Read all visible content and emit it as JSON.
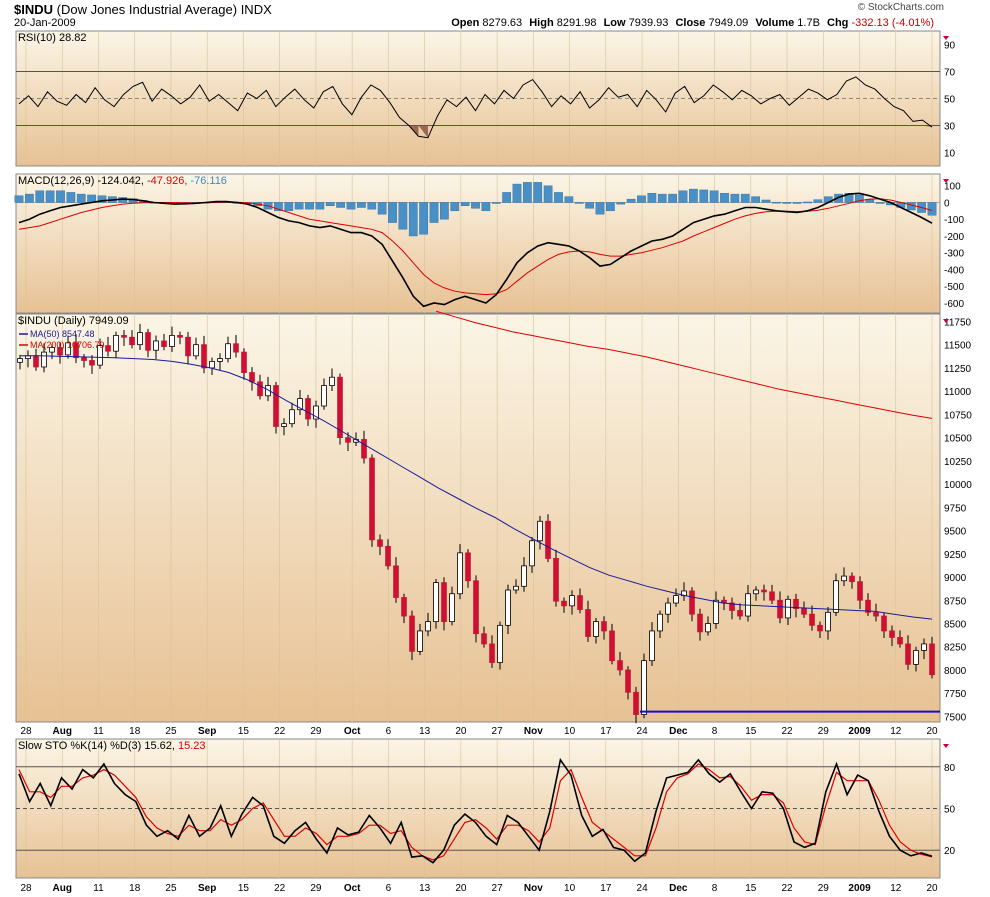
{
  "header": {
    "symbol": "$INDU",
    "name": "(Dow Jones Industrial Average)",
    "exchange": "INDX",
    "date": "20-Jan-2009",
    "brand": "© StockCharts.com",
    "open_label": "Open",
    "open": "8279.63",
    "high_label": "High",
    "high": "8291.98",
    "low_label": "Low",
    "low": "7939.93",
    "close_label": "Close",
    "close": "7949.09",
    "volume_label": "Volume",
    "volume": "1.7B",
    "chg_label": "Chg",
    "chg": "-332.13 (-4.01%)"
  },
  "colors": {
    "panel_bg_top": "#fbf5e6",
    "panel_bg_bottom": "#e7c193",
    "up": "#ffffff",
    "down": "#cc1133",
    "ma50": "#1a1a99",
    "ma200": "#dd0000",
    "macd_hist": "#4a90c8",
    "support": "#1010d0"
  },
  "chart_data": [
    {
      "type": "line",
      "panel": "rsi",
      "title": "RSI(10) 28.82",
      "y_ticks": [
        10,
        30,
        50,
        70,
        90
      ],
      "ylim": [
        0,
        100
      ],
      "reference_lines": [
        30,
        50,
        70
      ],
      "series": [
        {
          "name": "RSI(10)",
          "values": [
            46,
            52,
            44,
            55,
            48,
            45,
            53,
            47,
            58,
            49,
            44,
            53,
            59,
            62,
            48,
            57,
            52,
            46,
            51,
            60,
            48,
            53,
            47,
            41,
            54,
            50,
            56,
            44,
            51,
            57,
            49,
            43,
            55,
            59,
            46,
            38,
            51,
            60,
            56,
            47,
            36,
            30,
            22,
            21,
            37,
            49,
            44,
            51,
            41,
            53,
            46,
            56,
            50,
            60,
            64,
            55,
            44,
            52,
            46,
            55,
            43,
            49,
            58,
            51,
            53,
            44,
            56,
            49,
            40,
            54,
            59,
            47,
            52,
            60,
            55,
            49,
            56,
            52,
            46,
            50,
            53,
            45,
            51,
            57,
            54,
            49,
            53,
            63,
            66,
            60,
            57,
            50,
            44,
            41,
            33,
            34,
            28.82
          ]
        }
      ]
    },
    {
      "type": "line",
      "panel": "macd",
      "title": "MACD(12,26,9)",
      "values_text": {
        "macd": "-124.042",
        "signal": "-47.926",
        "hist": "-76.116"
      },
      "y_ticks": [
        100,
        0,
        -100,
        -200,
        -300,
        -400,
        -500,
        -600
      ],
      "ylim": [
        -660,
        170
      ],
      "series": [
        {
          "name": "MACD",
          "values": [
            -120,
            -100,
            -70,
            -50,
            -30,
            -20,
            -10,
            0,
            10,
            15,
            20,
            18,
            10,
            0,
            -5,
            -10,
            -8,
            -5,
            0,
            5,
            5,
            0,
            -10,
            -30,
            -60,
            -90,
            -110,
            -120,
            -140,
            -150,
            -140,
            -160,
            -180,
            -180,
            -200,
            -250,
            -350,
            -450,
            -560,
            -620,
            -600,
            -610,
            -580,
            -560,
            -580,
            -600,
            -550,
            -460,
            -360,
            -300,
            -260,
            -240,
            -250,
            -260,
            -290,
            -330,
            -380,
            -370,
            -330,
            -290,
            -260,
            -230,
            -220,
            -200,
            -160,
            -120,
            -100,
            -80,
            -70,
            -50,
            -30,
            -30,
            -40,
            -50,
            -55,
            -60,
            -50,
            -30,
            0,
            30,
            50,
            55,
            40,
            20,
            0,
            -30,
            -60,
            -90,
            -124.042
          ]
        },
        {
          "name": "Signal",
          "values": [
            -160,
            -150,
            -140,
            -120,
            -100,
            -80,
            -60,
            -45,
            -30,
            -20,
            -10,
            -5,
            -2,
            -1,
            0,
            -1,
            -2,
            -3,
            -1,
            0,
            1,
            1,
            -2,
            -10,
            -20,
            -40,
            -60,
            -80,
            -100,
            -110,
            -120,
            -130,
            -140,
            -150,
            -160,
            -180,
            -230,
            -290,
            -360,
            -430,
            -480,
            -510,
            -530,
            -540,
            -545,
            -550,
            -545,
            -520,
            -470,
            -420,
            -380,
            -340,
            -310,
            -295,
            -290,
            -295,
            -310,
            -320,
            -320,
            -310,
            -300,
            -285,
            -270,
            -250,
            -230,
            -200,
            -175,
            -150,
            -125,
            -100,
            -80,
            -65,
            -55,
            -52,
            -52,
            -54,
            -53,
            -47,
            -35,
            -20,
            -5,
            10,
            20,
            22,
            15,
            0,
            -15,
            -30,
            -47.926
          ]
        }
      ],
      "histogram": [
        40,
        50,
        70,
        70,
        70,
        60,
        50,
        45,
        40,
        35,
        30,
        23,
        12,
        1,
        -5,
        -9,
        -6,
        -2,
        1,
        5,
        4,
        -1,
        -8,
        -20,
        -40,
        -50,
        -50,
        -40,
        -40,
        -40,
        -20,
        -30,
        -40,
        -30,
        -40,
        -70,
        -120,
        -160,
        -200,
        -190,
        -120,
        -100,
        -50,
        -20,
        -35,
        -50,
        -5,
        60,
        110,
        120,
        120,
        100,
        60,
        35,
        0,
        -35,
        -70,
        -50,
        -10,
        20,
        40,
        55,
        50,
        50,
        70,
        80,
        75,
        70,
        55,
        50,
        50,
        35,
        15,
        2,
        -3,
        -6,
        3,
        17,
        35,
        50,
        55,
        45,
        20,
        -2,
        -15,
        -30,
        -45,
        -60,
        -76.116
      ]
    },
    {
      "type": "bar",
      "panel": "price",
      "title": "$INDU (Daily) 7949.09",
      "legend": [
        {
          "name": "MA(50) 8547.48",
          "color": "#1a1a99"
        },
        {
          "name": "MA(200) 10706.79",
          "color": "#dd0000"
        }
      ],
      "y_ticks": [
        7500,
        7750,
        8000,
        8250,
        8500,
        8750,
        9000,
        9250,
        9500,
        9750,
        10000,
        10250,
        10500,
        10750,
        11000,
        11250,
        11500,
        11750
      ],
      "ylim": [
        7440,
        11830
      ],
      "x_ticks": [
        "28",
        "Aug",
        "11",
        "18",
        "25",
        "Sep",
        "15",
        "22",
        "29",
        "Oct",
        "6",
        "13",
        "20",
        "27",
        "Nov",
        "10",
        "17",
        "24",
        "Dec",
        "8",
        "15",
        "22",
        "29",
        "2009",
        "12",
        "20"
      ],
      "closes": [
        11350,
        11380,
        11260,
        11420,
        11470,
        11390,
        11520,
        11360,
        11330,
        11280,
        11490,
        11430,
        11600,
        11580,
        11500,
        11630,
        11440,
        11540,
        11480,
        11600,
        11580,
        11380,
        11500,
        11250,
        11320,
        11350,
        11510,
        11420,
        11200,
        11100,
        10950,
        11060,
        10620,
        10650,
        10800,
        10920,
        10700,
        10840,
        11060,
        11150,
        10500,
        10450,
        10480,
        10280,
        9400,
        9330,
        9120,
        8780,
        8580,
        8200,
        8420,
        8520,
        8940,
        8520,
        8820,
        9260,
        8960,
        8390,
        8280,
        8080,
        8480,
        8860,
        8900,
        9120,
        9390,
        9600,
        9200,
        8740,
        8690,
        8800,
        8650,
        8360,
        8520,
        8420,
        8100,
        8000,
        7760,
        7520,
        8100,
        8420,
        8600,
        8720,
        8800,
        8850,
        8600,
        8410,
        8500,
        8750,
        8720,
        8640,
        8580,
        8820,
        8860,
        8840,
        8750,
        8560,
        8760,
        8660,
        8600,
        8480,
        8420,
        8620,
        8960,
        9010,
        8950,
        8750,
        8620,
        8580,
        8420,
        8350,
        8280,
        8060,
        8210,
        8280,
        7949.09
      ],
      "ma50": [
        11380,
        11380,
        11375,
        11370,
        11365,
        11360,
        11350,
        11340,
        11320,
        11290,
        11250,
        11200,
        11120,
        11020,
        10900,
        10790,
        10680,
        10560,
        10440,
        10320,
        10200,
        10080,
        9960,
        9850,
        9740,
        9640,
        9520,
        9410,
        9300,
        9200,
        9100,
        9020,
        8960,
        8900,
        8850,
        8800,
        8760,
        8720,
        8700,
        8690,
        8680,
        8670,
        8660,
        8650,
        8640,
        8630,
        8600,
        8570,
        8547.48
      ],
      "ma200": [
        11860,
        11800,
        11740,
        11690,
        11640,
        11600,
        11560,
        11520,
        11480,
        11450,
        11410,
        11370,
        11320,
        11270,
        11220,
        11170,
        11120,
        11070,
        11020,
        10980,
        10940,
        10900,
        10860,
        10820,
        10780,
        10740,
        10706.79
      ],
      "support_line": 7552
    },
    {
      "type": "line",
      "panel": "stochastic",
      "title": "Slow STO %K(14) %D(3)",
      "values_text": {
        "k": "15.62",
        "d": "15.23"
      },
      "y_ticks": [
        20,
        50,
        80
      ],
      "ylim": [
        0,
        100
      ],
      "reference_lines": [
        20,
        50,
        80
      ],
      "series": [
        {
          "name": "%K(14)",
          "values": [
            75,
            55,
            68,
            52,
            72,
            64,
            78,
            72,
            82,
            68,
            60,
            55,
            38,
            30,
            34,
            28,
            45,
            30,
            36,
            52,
            30,
            46,
            58,
            52,
            30,
            25,
            34,
            40,
            28,
            18,
            36,
            31,
            33,
            45,
            36,
            25,
            40,
            15,
            16,
            11,
            20,
            38,
            46,
            40,
            30,
            24,
            45,
            40,
            30,
            20,
            48,
            85,
            74,
            45,
            30,
            35,
            22,
            20,
            12,
            18,
            48,
            72,
            74,
            76,
            85,
            75,
            69,
            75,
            62,
            50,
            62,
            61,
            50,
            26,
            22,
            25,
            62,
            82,
            60,
            74,
            70,
            48,
            30,
            20,
            16,
            18,
            15.62
          ]
        },
        {
          "name": "%D(3)",
          "values": [
            78,
            62,
            62,
            58,
            66,
            66,
            72,
            74,
            78,
            74,
            66,
            58,
            44,
            36,
            32,
            30,
            38,
            34,
            34,
            42,
            38,
            42,
            50,
            54,
            42,
            30,
            30,
            36,
            32,
            24,
            30,
            30,
            32,
            38,
            38,
            32,
            34,
            22,
            16,
            13,
            16,
            28,
            40,
            42,
            36,
            28,
            38,
            38,
            34,
            26,
            36,
            70,
            78,
            58,
            40,
            34,
            28,
            22,
            16,
            16,
            36,
            62,
            72,
            75,
            82,
            78,
            72,
            73,
            66,
            56,
            60,
            60,
            54,
            36,
            26,
            24,
            52,
            76,
            70,
            70,
            70,
            56,
            38,
            26,
            20,
            17,
            15.23
          ]
        }
      ]
    }
  ],
  "date_axis": {
    "ticks": [
      "28",
      "Aug",
      "11",
      "18",
      "25",
      "Sep",
      "15",
      "22",
      "29",
      "Oct",
      "6",
      "13",
      "20",
      "27",
      "Nov",
      "10",
      "17",
      "24",
      "Dec",
      "8",
      "15",
      "22",
      "29",
      "2009",
      "12",
      "20"
    ],
    "bold": [
      "Aug",
      "Sep",
      "Oct",
      "Nov",
      "Dec",
      "2009"
    ]
  }
}
